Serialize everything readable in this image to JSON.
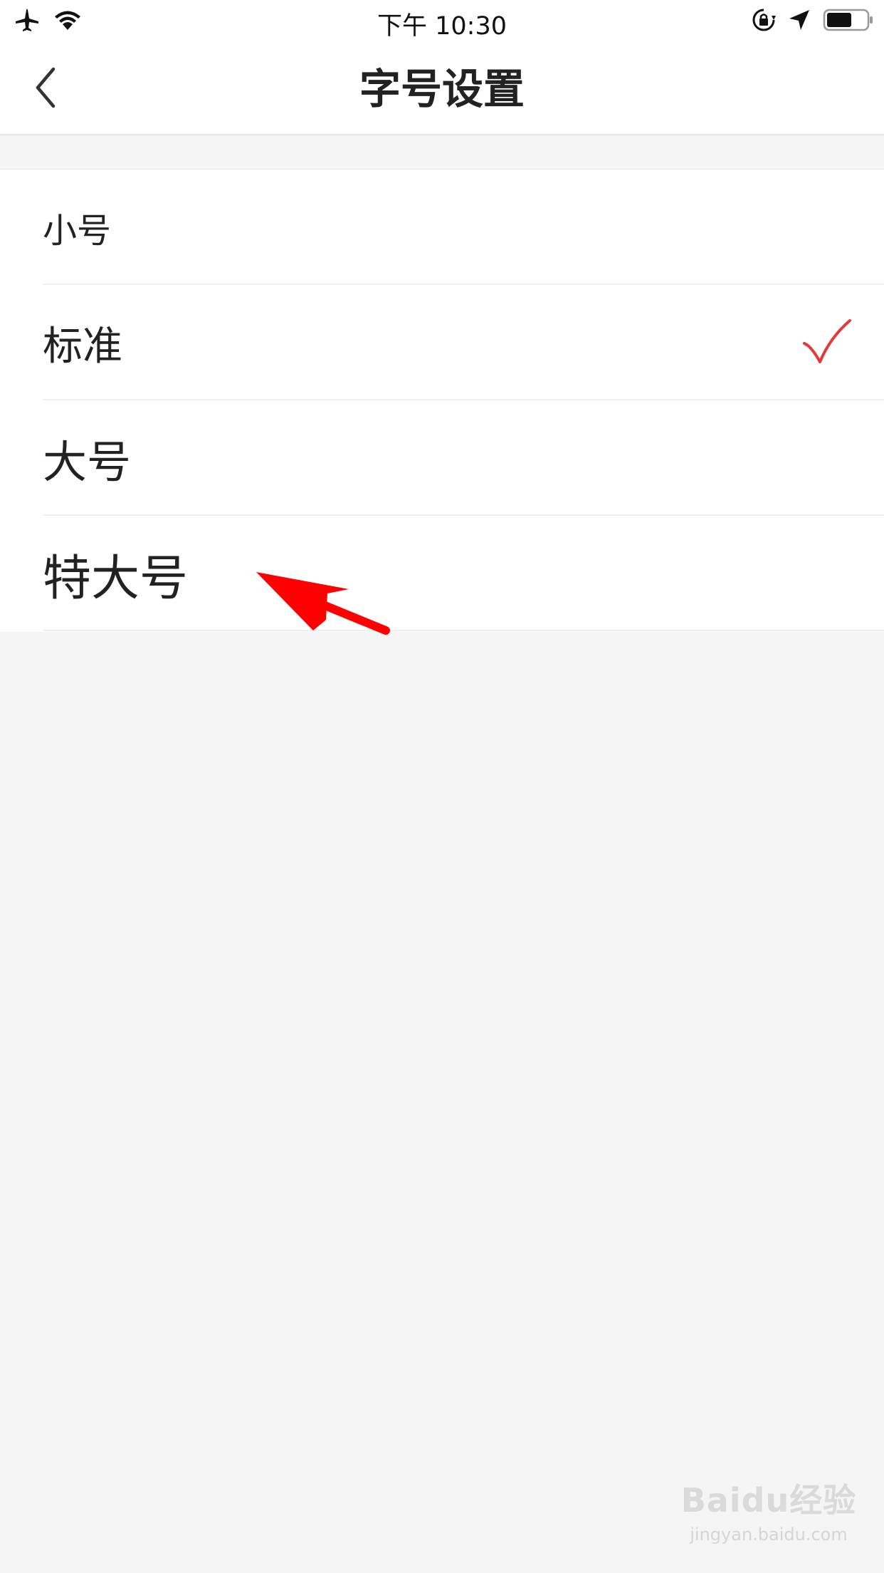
{
  "status_bar": {
    "time": "下午 10:30",
    "icons_left": [
      "airplane-icon",
      "wifi-icon"
    ],
    "icons_right": [
      "orientation-lock-icon",
      "location-icon",
      "battery-icon"
    ]
  },
  "nav": {
    "title": "字号设置",
    "back_icon": "chevron-left-icon"
  },
  "options": [
    {
      "label": "小号",
      "selected": false
    },
    {
      "label": "标准",
      "selected": true
    },
    {
      "label": "大号",
      "selected": false
    },
    {
      "label": "特大号",
      "selected": false
    }
  ],
  "colors": {
    "accent": "#e53935",
    "annotation_arrow": "#ff0000",
    "background": "#f5f5f5",
    "surface": "#ffffff"
  },
  "watermark": {
    "logo": "Baidu经验",
    "url": "jingyan.baidu.com"
  }
}
